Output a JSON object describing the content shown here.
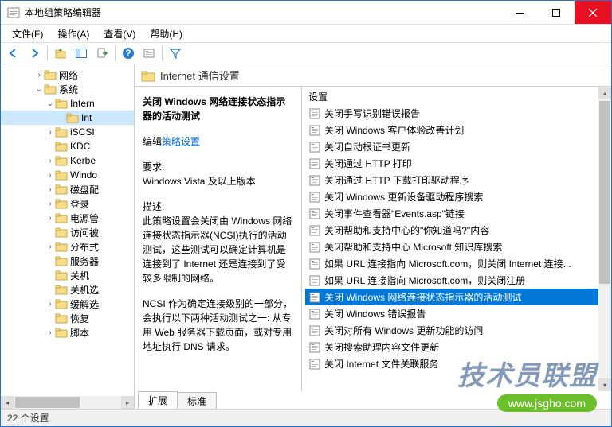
{
  "window": {
    "title": "本地组策略编辑器"
  },
  "menus": {
    "file": "文件(F)",
    "action": "操作(A)",
    "view": "查看(V)",
    "help": "帮助(H)"
  },
  "tree": {
    "items": [
      {
        "indent": 3,
        "toggle": ">",
        "label": "网络"
      },
      {
        "indent": 3,
        "toggle": "v",
        "label": "系统"
      },
      {
        "indent": 4,
        "toggle": "v",
        "label": "Intern",
        "cut": true
      },
      {
        "indent": 5,
        "toggle": "",
        "label": "Int",
        "selected": true,
        "cut": true
      },
      {
        "indent": 4,
        "toggle": ">",
        "label": "iSCSI"
      },
      {
        "indent": 4,
        "toggle": "",
        "label": "KDC"
      },
      {
        "indent": 4,
        "toggle": ">",
        "label": "Kerbe",
        "cut": true
      },
      {
        "indent": 4,
        "toggle": ">",
        "label": "Windo",
        "cut": true
      },
      {
        "indent": 4,
        "toggle": ">",
        "label": "磁盘配",
        "cut": true
      },
      {
        "indent": 4,
        "toggle": ">",
        "label": "登录"
      },
      {
        "indent": 4,
        "toggle": ">",
        "label": "电源管",
        "cut": true
      },
      {
        "indent": 4,
        "toggle": "",
        "label": "访问被",
        "cut": true
      },
      {
        "indent": 4,
        "toggle": ">",
        "label": "分布式",
        "cut": true
      },
      {
        "indent": 4,
        "toggle": "",
        "label": "服务器",
        "cut": true
      },
      {
        "indent": 4,
        "toggle": "",
        "label": "关机"
      },
      {
        "indent": 4,
        "toggle": "",
        "label": "关机选",
        "cut": true
      },
      {
        "indent": 4,
        "toggle": ">",
        "label": "缓解选",
        "cut": true
      },
      {
        "indent": 4,
        "toggle": "",
        "label": "恢复"
      },
      {
        "indent": 4,
        "toggle": ">",
        "label": "脚本"
      }
    ]
  },
  "path": {
    "label": "Internet 通信设置"
  },
  "description": {
    "title": "关闭 Windows 网络连接状态指示器的活动测试",
    "edit_prefix": "编辑",
    "edit_link": "策略设置",
    "req_label": "要求:",
    "req_text": "Windows Vista 及以上版本",
    "desc_label": "描述:",
    "desc_p1": "此策略设置会关闭由 Windows 网络连接状态指示器(NCSI)执行的活动测试，这些测试可以确定计算机是连接到了 Internet 还是连接到了受较多限制的网络。",
    "desc_p2": "NCSI 作为确定连接级别的一部分，会执行以下两种活动测试之一: 从专用 Web 服务器下载页面，或对专用地址执行 DNS 请求。"
  },
  "settings": {
    "header": "设置",
    "items": [
      "关闭手写识别错误报告",
      "关闭 Windows 客户体验改善计划",
      "关闭自动根证书更新",
      "关闭通过 HTTP 打印",
      "关闭通过 HTTP 下载打印驱动程序",
      "关闭 Windows 更新设备驱动程序搜索",
      "关闭事件查看器\"Events.asp\"链接",
      "关闭帮助和支持中心的\"你知道吗?\"内容",
      "关闭帮助和支持中心 Microsoft 知识库搜索",
      "如果 URL 连接指向 Microsoft.com，则关闭 Internet 连接...",
      "如果 URL 连接指向 Microsoft.com，则关闭注册",
      "关闭 Windows 网络连接状态指示器的活动测试",
      "关闭 Windows 错误报告",
      "关闭对所有 Windows 更新功能的访问",
      "关闭搜索助理内容文件更新",
      "关闭 Internet 文件关联服务"
    ],
    "selected_index": 11
  },
  "tabs": {
    "extended": "扩展",
    "standard": "标准"
  },
  "status": {
    "text": "22 个设置"
  },
  "watermark": {
    "logo": "技术员联盟",
    "url": "www.jsgho.com"
  }
}
